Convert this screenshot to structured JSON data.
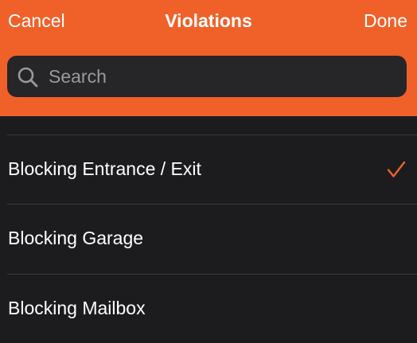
{
  "nav": {
    "cancel_label": "Cancel",
    "title": "Violations",
    "done_label": "Done"
  },
  "search": {
    "placeholder": "Search",
    "value": "",
    "icon": "search-icon"
  },
  "violations": [
    {
      "label": "Blocking Entrance / Exit",
      "selected": true
    },
    {
      "label": "Blocking Garage",
      "selected": false
    },
    {
      "label": "Blocking Mailbox",
      "selected": false
    }
  ],
  "colors": {
    "accent": "#f0612a",
    "background": "#1c1c1e",
    "search_field": "#262628",
    "divider": "#3a3a3c",
    "text": "#ffffff",
    "placeholder": "#9a9a9e"
  }
}
